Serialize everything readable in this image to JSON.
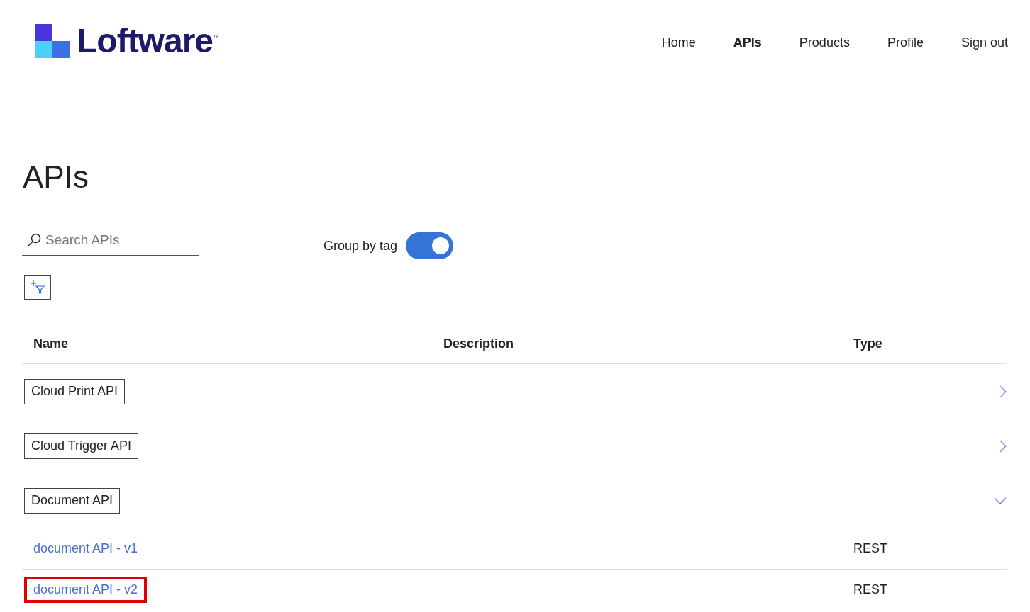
{
  "logo": {
    "text": "Loftware",
    "mark": "™"
  },
  "nav": [
    {
      "label": "Home",
      "selected": false
    },
    {
      "label": "APIs",
      "selected": true
    },
    {
      "label": "Products",
      "selected": false
    },
    {
      "label": "Profile",
      "selected": false
    },
    {
      "label": "Sign out",
      "selected": false
    }
  ],
  "page_title": "APIs",
  "search": {
    "placeholder": "Search APIs"
  },
  "group_by_tag": {
    "label": "Group by tag",
    "on": true
  },
  "table": {
    "columns": [
      "Name",
      "Description",
      "Type"
    ],
    "groups": [
      {
        "tag": "Cloud Print API",
        "expanded": false
      },
      {
        "tag": "Cloud Trigger API",
        "expanded": false
      },
      {
        "tag": "Document API",
        "expanded": true,
        "apis": [
          {
            "name": "document API - v1",
            "type": "REST",
            "highlighted": false
          },
          {
            "name": "document API - v2",
            "type": "REST",
            "highlighted": true
          }
        ]
      }
    ]
  }
}
